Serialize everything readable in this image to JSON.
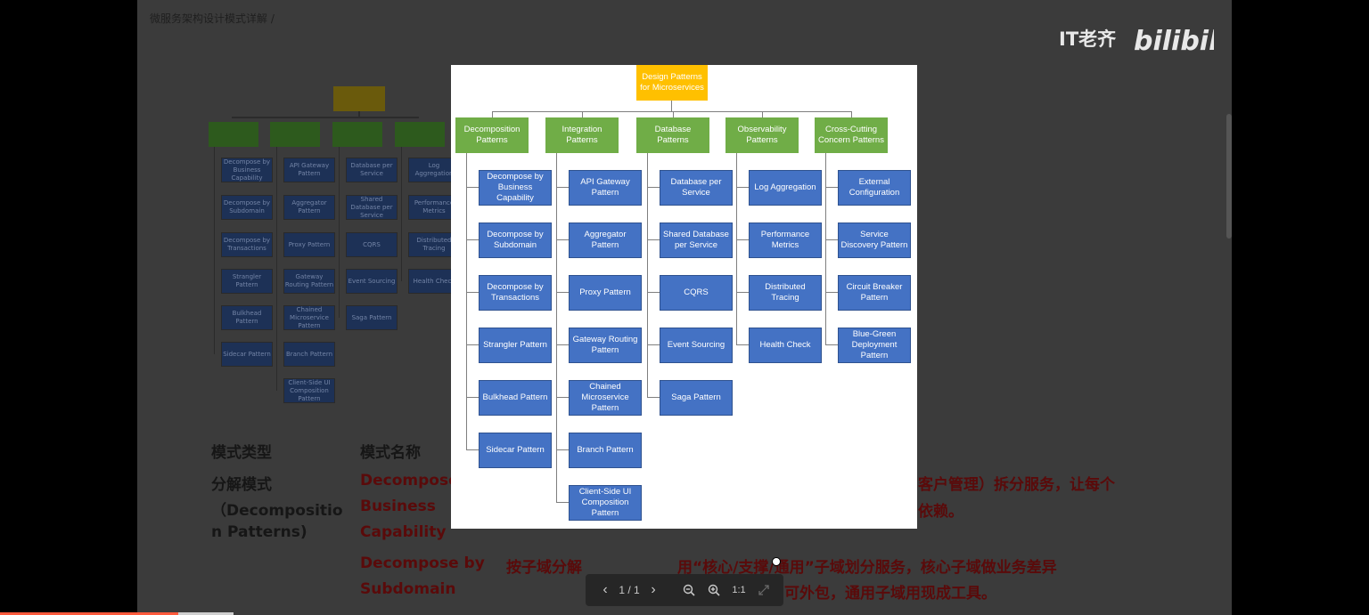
{
  "breadcrumb": "微服务架构设计模式详解 /",
  "watermark": {
    "text": "IT老齐",
    "logo": "bilibili"
  },
  "background_chart": {
    "columns": [
      [
        "Decompose by Business Capability",
        "Decompose by Subdomain",
        "Decompose by Transactions",
        "Strangler Pattern",
        "Bulkhead Pattern",
        "Sidecar Pattern"
      ],
      [
        "API Gateway Pattern",
        "Aggregator Pattern",
        "Proxy Pattern",
        "Gateway Routing Pattern",
        "Chained Microservice Pattern",
        "Branch Pattern",
        "Client-Side UI Composition Pattern"
      ],
      [
        "Database per Service",
        "Shared Database per Service",
        "CQRS",
        "Event Sourcing",
        "Saga Pattern"
      ],
      [
        "Log Aggregation",
        "Performance Metrics",
        "Distributed Tracing",
        "Health Check"
      ]
    ]
  },
  "article": {
    "header_type": "模式类型",
    "header_name": "模式名称",
    "type_1": "分解模式",
    "type_1_en_a": "（Decompositio",
    "type_1_en_b": "n Patterns)",
    "name_1a": "Decompose",
    "name_1b": "Business",
    "name_1c": "Capability",
    "desc_1a": "客户管理）拆分服务，让每个",
    "desc_1b": "依赖。",
    "name_2a": "Decompose by",
    "name_2b": "Subdomain",
    "cn_2": "按子域分解",
    "desc_2a": "用“核心/支撑/通用”子域划分服务，核心子域做业务差异",
    "desc_2b": "可外包，通用子域用现成工具。"
  },
  "lightbox": {
    "root": "Design Patterns for Microservices",
    "columns": [
      {
        "head": "Decomposition Patterns",
        "items": [
          "Decompose by Business Capability",
          "Decompose by Subdomain",
          "Decompose by Transactions",
          "Strangler Pattern",
          "Bulkhead Pattern",
          "Sidecar Pattern"
        ]
      },
      {
        "head": "Integration Patterns",
        "items": [
          "API Gateway Pattern",
          "Aggregator Pattern",
          "Proxy Pattern",
          "Gateway Routing Pattern",
          "Chained Microservice Pattern",
          "Branch Pattern",
          "Client-Side UI Composition Pattern"
        ]
      },
      {
        "head": "Database Patterns",
        "items": [
          "Database per Service",
          "Shared Database per Service",
          "CQRS",
          "Event Sourcing",
          "Saga Pattern"
        ]
      },
      {
        "head": "Observability Patterns",
        "items": [
          "Log Aggregation",
          "Performance Metrics",
          "Distributed Tracing",
          "Health Check"
        ]
      },
      {
        "head": "Cross-Cutting Concern Patterns",
        "items": [
          "External Configuration",
          "Service Discovery Pattern",
          "Circuit Breaker Pattern",
          "Blue-Green Deployment Pattern"
        ]
      }
    ]
  },
  "toolbar": {
    "prev": "‹",
    "page_indicator": "1 / 1",
    "next": "›",
    "zoom_out": "zoom-out",
    "zoom_in": "zoom-in",
    "actual_size": "1:1",
    "fullscreen": "fullscreen"
  },
  "colors": {
    "root": "#ffc000",
    "head": "#70ad47",
    "item": "#4472c4"
  }
}
